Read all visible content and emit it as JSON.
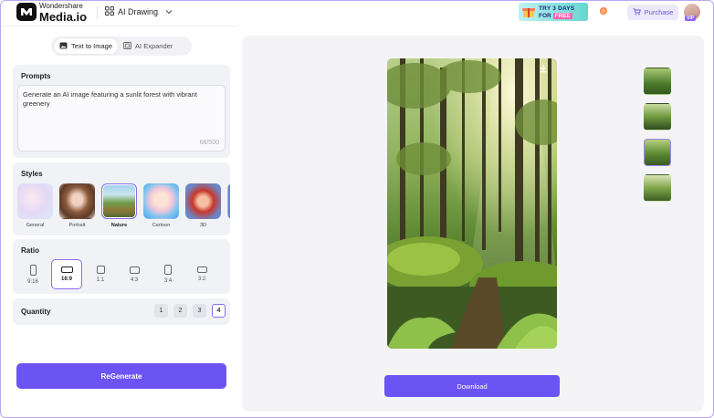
{
  "header": {
    "brand_top": "Wondershare",
    "brand_bottom": "Media.io",
    "nav_label": "AI Drawing",
    "promo_line1": "TRY 3 DAYS",
    "promo_line2_prefix": "FOR",
    "promo_line2_free": "FREE",
    "purchase_label": "Purchase",
    "vip_label": "VIP"
  },
  "mode_tabs": [
    {
      "label": "Text to Image",
      "active": true
    },
    {
      "label": "AI Expander",
      "active": false
    }
  ],
  "prompts": {
    "title": "Prompts",
    "text": "Generate an AI image featuring a sunlit forest with vibrant greenery",
    "count": "68/500"
  },
  "styles": {
    "title": "Styles",
    "items": [
      {
        "label": "General",
        "selected": false
      },
      {
        "label": "Portrait",
        "selected": false
      },
      {
        "label": "Nature",
        "selected": true
      },
      {
        "label": "Cartoon",
        "selected": false
      },
      {
        "label": "3D",
        "selected": false
      }
    ]
  },
  "ratio": {
    "title": "Ratio",
    "items": [
      {
        "label": "9:16",
        "selected": false
      },
      {
        "label": "16:9",
        "selected": true
      },
      {
        "label": "1:1",
        "selected": false
      },
      {
        "label": "4:3",
        "selected": false
      },
      {
        "label": "3:4",
        "selected": false
      },
      {
        "label": "3:2",
        "selected": false
      }
    ]
  },
  "quantity": {
    "title": "Quantity",
    "options": [
      "1",
      "2",
      "3",
      "4"
    ],
    "selected": "4"
  },
  "regenerate_label": "ReGenerate",
  "download_label": "Download",
  "thumbnails": [
    {
      "selected": false
    },
    {
      "selected": false
    },
    {
      "selected": true
    },
    {
      "selected": false
    }
  ],
  "colors": {
    "accent": "#6b54f3",
    "selection_border": "#8b6cf0",
    "panel_bg": "#f1f2f6",
    "frame_border": "#b9a8f2"
  },
  "icons": {
    "brand": "media-io-logo-icon",
    "nav": "grid-icon",
    "nav_caret": "chevron-down-icon",
    "purchase": "cart-icon",
    "text_to_image": "image-icon",
    "ai_expander": "expand-icon",
    "image_download": "download-icon"
  }
}
